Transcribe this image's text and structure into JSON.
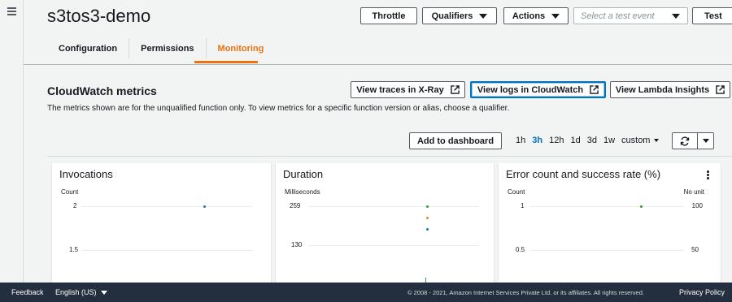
{
  "header": {
    "title": "s3tos3-demo",
    "buttons": {
      "throttle": "Throttle",
      "qualifiers": "Qualifiers",
      "actions": "Actions",
      "test": "Test"
    },
    "test_event_placeholder": "Select a test event"
  },
  "tabs": [
    {
      "label": "Configuration",
      "active": false
    },
    {
      "label": "Permissions",
      "active": false
    },
    {
      "label": "Monitoring",
      "active": true
    }
  ],
  "monitoring": {
    "title": "CloudWatch metrics",
    "description": "The metrics shown are for the unqualified function only. To view metrics for a specific function version or alias, choose a qualifier.",
    "buttons": {
      "xray": "View traces in X-Ray",
      "logs": "View logs in CloudWatch",
      "insights": "View Lambda Insights",
      "dashboard": "Add to dashboard"
    },
    "time_ranges": [
      "1h",
      "3h",
      "12h",
      "1d",
      "3d",
      "1w"
    ],
    "active_range": "3h",
    "custom_label": "custom"
  },
  "cards": {
    "invocations": {
      "title": "Invocations",
      "unit": "Count",
      "ticks": [
        "2",
        "1.5"
      ]
    },
    "duration": {
      "title": "Duration",
      "unit": "Milliseconds",
      "ticks": [
        "259",
        "130"
      ]
    },
    "errors": {
      "title": "Error count and success rate (%)",
      "unit_left": "Count",
      "unit_right": "No unit",
      "ticks_left": [
        "1",
        "0.5"
      ],
      "ticks_right": [
        "100",
        "50"
      ]
    }
  },
  "colors": {
    "accent": "#ec7211",
    "link": "#0073bb",
    "footer_bg": "#232f3e",
    "series_blue": "#1f77b4",
    "series_orange": "#ff7f0e",
    "series_green": "#2ca02c"
  },
  "footer": {
    "feedback": "Feedback",
    "language": "English (US)",
    "copyright": "© 2008 - 2021, Amazon Internet Services Private Ltd. or its affiliates. All rights reserved.",
    "privacy": "Privacy Policy"
  }
}
